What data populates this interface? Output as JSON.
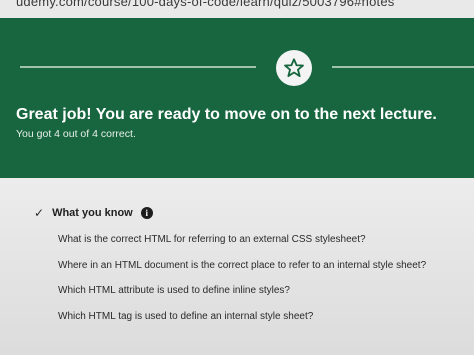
{
  "browser": {
    "url": "udemy.com/course/100-days-of-code/learn/quiz/5003796#notes"
  },
  "banner": {
    "headline": "Great job! You are ready to move on to the next lecture.",
    "score_text": "You got 4 out of 4 correct.",
    "badge_icon": "star-icon"
  },
  "summary": {
    "title": "What you know",
    "check_icon": "checkmark-icon",
    "info_icon": "info-icon",
    "questions": [
      "What is the correct HTML for referring to an external CSS stylesheet?",
      "Where in an HTML document is the correct place to refer to an internal style sheet?",
      "Which HTML attribute is used to define inline styles?",
      "Which HTML tag is used to define an internal style sheet?"
    ]
  },
  "colors": {
    "banner": "#17663f",
    "page": "#e6e6e6"
  }
}
